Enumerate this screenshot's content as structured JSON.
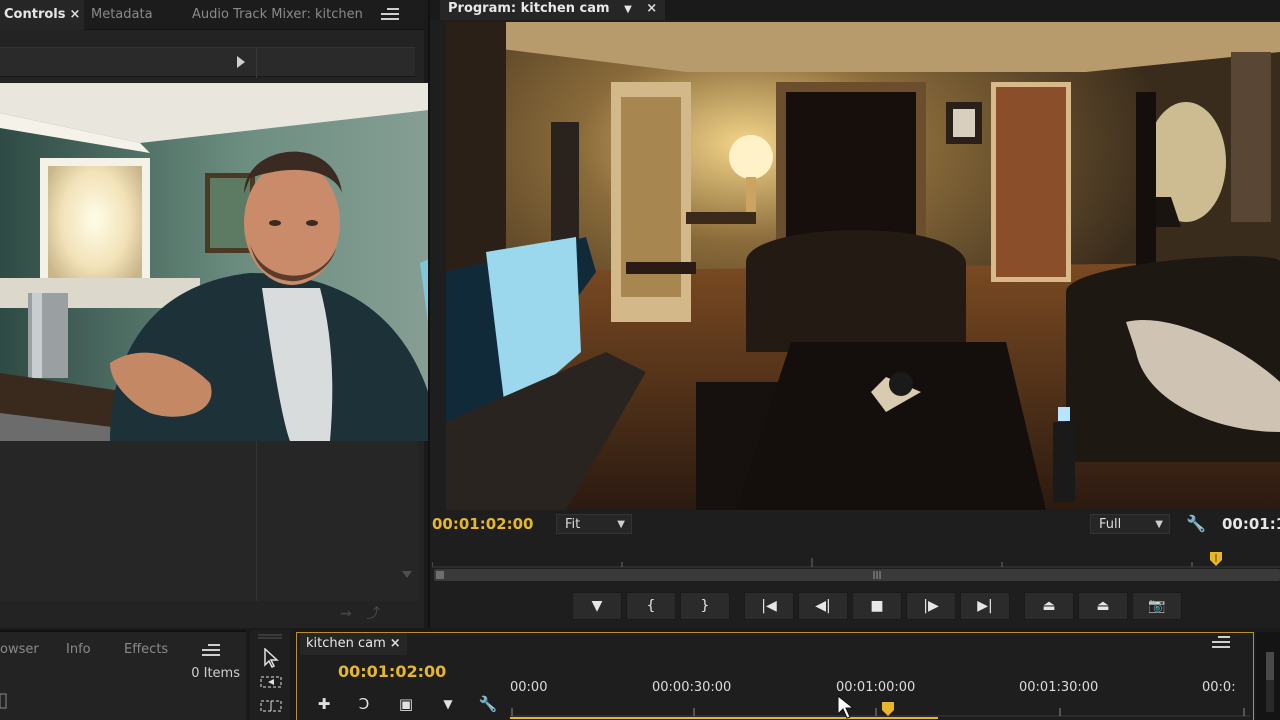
{
  "source_panel": {
    "tabs": [
      {
        "label": "Controls",
        "active": true,
        "closable": true
      },
      {
        "label": "Metadata",
        "active": false
      },
      {
        "label": "Audio Track Mixer: kitchen",
        "active": false
      }
    ],
    "bottom_icons": [
      "export-frame-icon",
      "share-icon"
    ]
  },
  "program_monitor": {
    "tab_label": "Program: kitchen cam",
    "timecode": "00:01:02:00",
    "zoom": {
      "value": "Fit"
    },
    "resolution": {
      "value": "Full"
    },
    "duration_partial": "00:01:1",
    "transport": [
      {
        "name": "add-marker-button",
        "icon": "marker-icon",
        "glyph": "▼"
      },
      {
        "name": "mark-in-button",
        "icon": "mark-in-icon",
        "glyph": "{"
      },
      {
        "name": "mark-out-button",
        "icon": "mark-out-icon",
        "glyph": "}"
      },
      {
        "name": "go-to-in-button",
        "icon": "go-to-in-icon",
        "glyph": "|◀"
      },
      {
        "name": "step-back-button",
        "icon": "step-back-icon",
        "glyph": "◀|"
      },
      {
        "name": "stop-button",
        "icon": "stop-icon",
        "glyph": "■"
      },
      {
        "name": "step-forward-button",
        "icon": "step-forward-icon",
        "glyph": "|▶"
      },
      {
        "name": "go-to-out-button",
        "icon": "go-to-out-icon",
        "glyph": "▶|"
      },
      {
        "name": "lift-button",
        "icon": "lift-icon",
        "glyph": "⏏"
      },
      {
        "name": "extract-button",
        "icon": "extract-icon",
        "glyph": "⏏"
      },
      {
        "name": "export-frame-button",
        "icon": "camera-icon",
        "glyph": "📷"
      }
    ]
  },
  "lower_left": {
    "tabs": [
      {
        "label": "owser"
      },
      {
        "label": "Info"
      },
      {
        "label": "Effects"
      }
    ],
    "items_count": "0 Items"
  },
  "timeline": {
    "tab_label": "kitchen cam",
    "timecode": "00:01:02:00",
    "ruler_labels": [
      "00:00",
      "00:00:30:00",
      "00:01:00:00",
      "00:01:30:00",
      "00:0:"
    ]
  },
  "colors": {
    "accent_timecode": "#e8b62a",
    "panel_bg": "#232323",
    "playhead": "#e8b62a"
  }
}
